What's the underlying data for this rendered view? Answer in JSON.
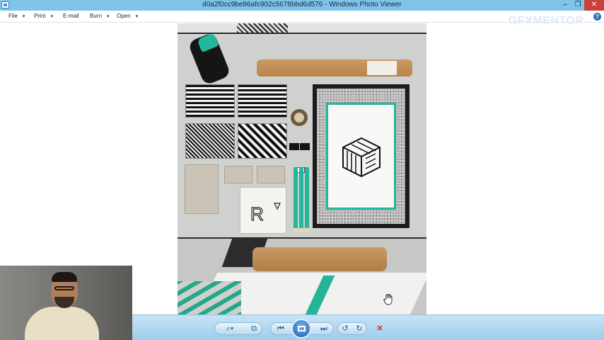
{
  "window": {
    "title": "d0a2f0cc9be86afc902c5678bbd6d576 - Windows Photo Viewer",
    "minimize_glyph": "–",
    "restore_glyph": "❐",
    "close_glyph": "✕"
  },
  "menu": {
    "items": [
      {
        "label": "File",
        "has_dropdown": true
      },
      {
        "label": "Print",
        "has_dropdown": true
      },
      {
        "label": "E-mail",
        "has_dropdown": false
      },
      {
        "label": "Burn",
        "has_dropdown": true
      },
      {
        "label": "Open",
        "has_dropdown": true
      }
    ],
    "dropdown_glyph": "▾",
    "help_glyph": "?"
  },
  "watermark": "GFXMENTOR",
  "toolbar": {
    "zoom_glyph": "⌕▾",
    "actual_size_glyph": "⧉",
    "previous_glyph": "⏮",
    "next_glyph": "⏭",
    "rotate_ccw_glyph": "↺",
    "rotate_cw_glyph": "↻",
    "delete_glyph": "✕"
  },
  "icons": {
    "cursor": "hand-cursor-icon"
  },
  "colors": {
    "titlebar": "#7ec3ea",
    "close_button": "#c9413a",
    "toolbar": "#9fcdeb",
    "accent_teal": "#21b89b"
  }
}
